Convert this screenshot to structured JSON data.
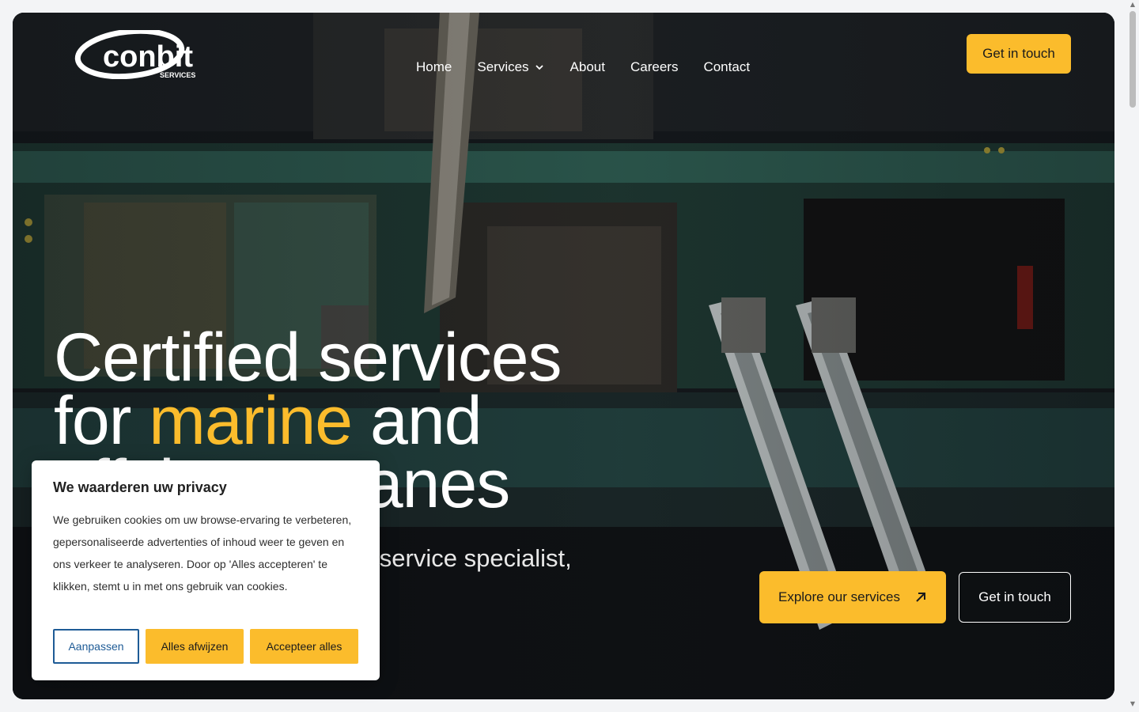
{
  "brand": {
    "logo_text": "conbit",
    "logo_subtext": "SERVICES"
  },
  "nav": {
    "items": [
      {
        "label": "Home"
      },
      {
        "label": "Services"
      },
      {
        "label": "About"
      },
      {
        "label": "Careers"
      },
      {
        "label": "Contact"
      }
    ],
    "cta": "Get in touch"
  },
  "hero": {
    "line1": "Certified services",
    "line2_pre": "for ",
    "line2_accent": "marine",
    "line2_post": " and",
    "line3": "offshore cranes",
    "subtitle": "Conbit Services is your crane service specialist,",
    "explore_label": "Explore our services",
    "contact_label": "Get in touch"
  },
  "cookie": {
    "title": "We waarderen uw privacy",
    "body": "We gebruiken cookies om uw browse-ervaring te verbeteren, gepersonaliseerde advertenties of inhoud weer te geven en ons verkeer te analyseren. Door op 'Alles accepteren' te klikken, stemt u in met ons gebruik van cookies.",
    "customize": "Aanpassen",
    "reject": "Alles afwijzen",
    "accept": "Accepteer alles"
  },
  "colors": {
    "accent": "#fbbc2c",
    "link_blue": "#1e5b96"
  }
}
